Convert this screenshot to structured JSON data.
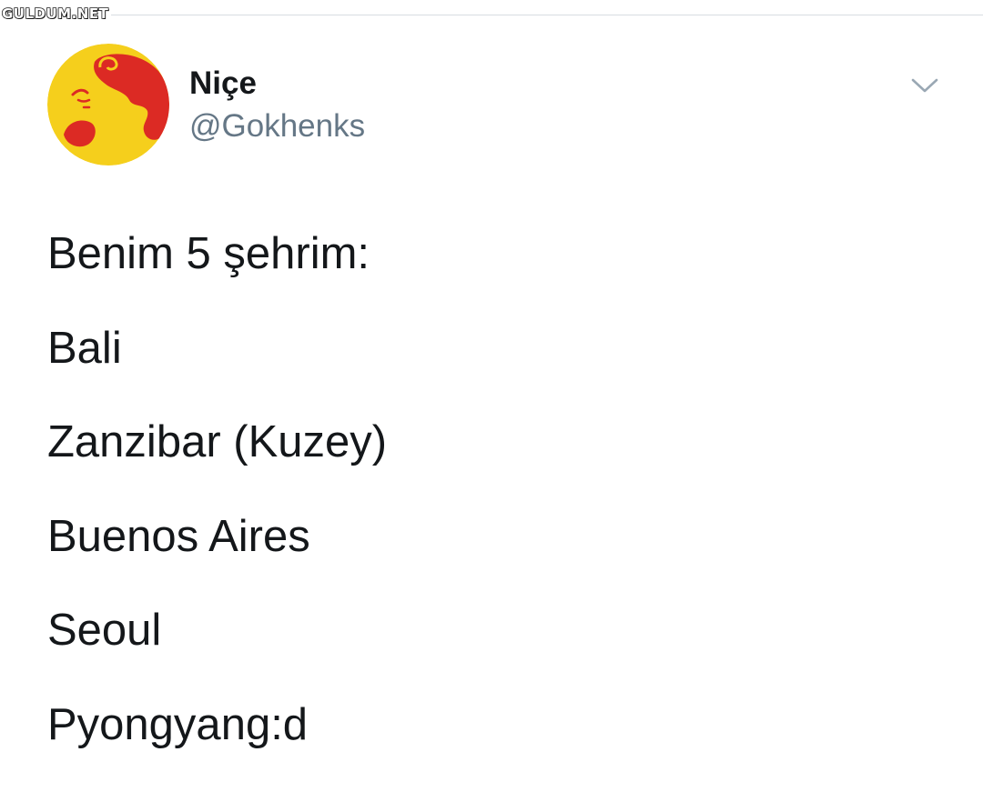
{
  "watermark": {
    "text": "GULDUM.NET"
  },
  "user": {
    "display_name": "Niçe",
    "handle": "@Gokhenks",
    "avatar_icon": "nietzsche-caricature-avatar",
    "avatar_colors": {
      "background": "#f5cf1c",
      "figure": "#dc2a24"
    }
  },
  "menu": {
    "icon": "chevron-down-icon",
    "color": "#9aa8b4"
  },
  "tweet": {
    "lines": [
      "Benim 5 şehrim:",
      "Bali",
      "Zanzibar (Kuzey)",
      "Buenos Aires",
      "Seoul",
      "Pyongyang:d"
    ]
  }
}
